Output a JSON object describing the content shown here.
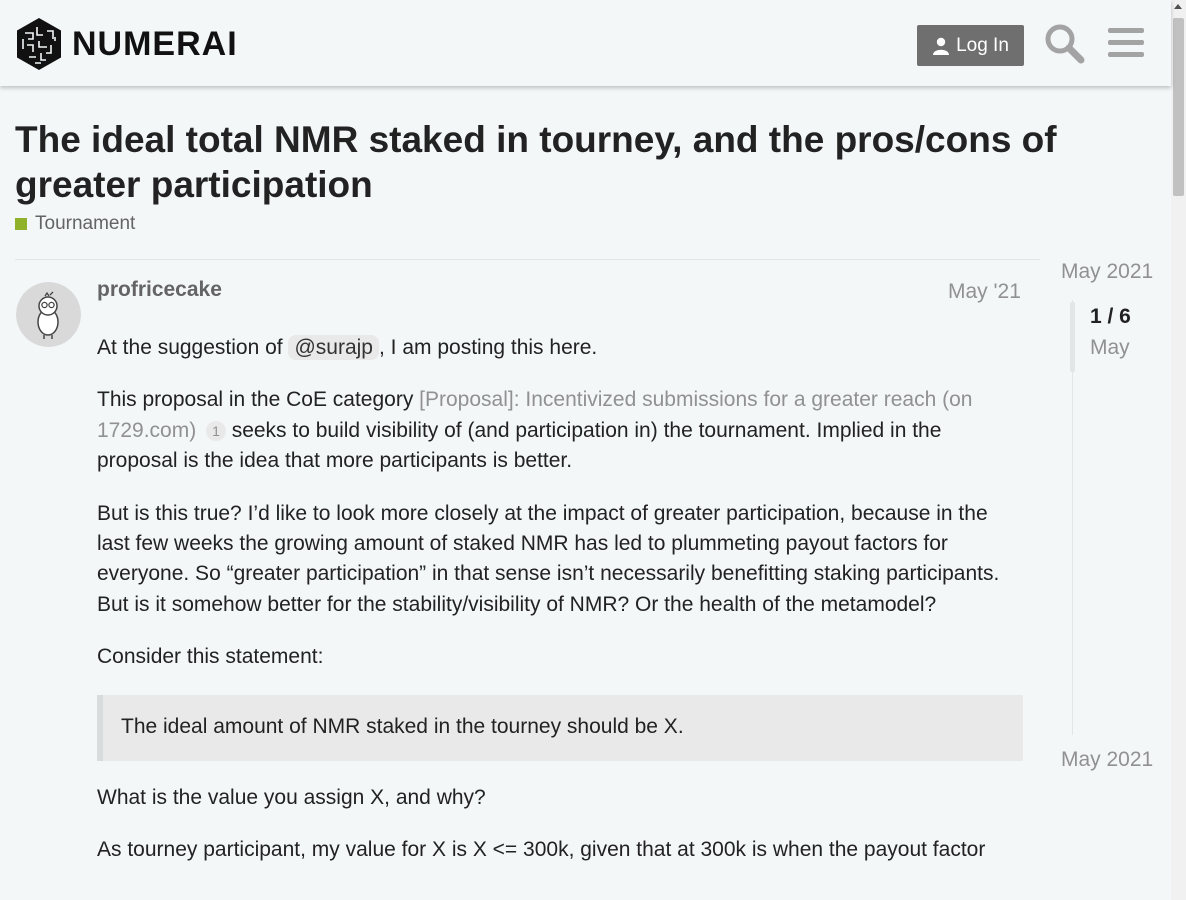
{
  "header": {
    "brand": "NUMERAI",
    "login_label": "Log In",
    "icons": [
      "search-icon",
      "hamburger-menu-icon"
    ]
  },
  "topic": {
    "title": "The ideal total NMR staked in tourney, and the pros/cons of greater participation",
    "category": "Tournament",
    "category_color": "#8fb22a"
  },
  "post": {
    "username": "profricecake",
    "date": "May '21",
    "p1_before": "At the suggestion of ",
    "p1_mention": "@surajp",
    "p1_after": ", I am posting this here.",
    "p2_before": "This proposal in the CoE category ",
    "p2_link": "[Proposal]: Incentivized submissions for a greater reach (on 1729.com)",
    "p2_count": "1",
    "p2_after": " seeks to build visibility of (and participation in) the tournament. Implied in the proposal is the idea that more participants is better.",
    "p3": "But is this true? I’d like to look more closely at the impact of greater participation, because in the last few weeks the growing amount of staked NMR has led to plummeting payout factors for everyone. So “greater participation” in that sense isn’t necessarily benefitting staking participants. But is it somehow better for the stability/visibility of NMR? Or the health of the metamodel?",
    "p4": "Consider this statement:",
    "quote": "The ideal amount of NMR staked in the tourney should be X.",
    "p5": "What is the value you assign X, and why?",
    "p6": "As tourney participant, my value for X is X <= 300k, given that at 300k is when the payout factor"
  },
  "timeline": {
    "start_label": "May 2021",
    "position": "1 / 6",
    "current_date": "May",
    "end_label": "May 2021"
  }
}
